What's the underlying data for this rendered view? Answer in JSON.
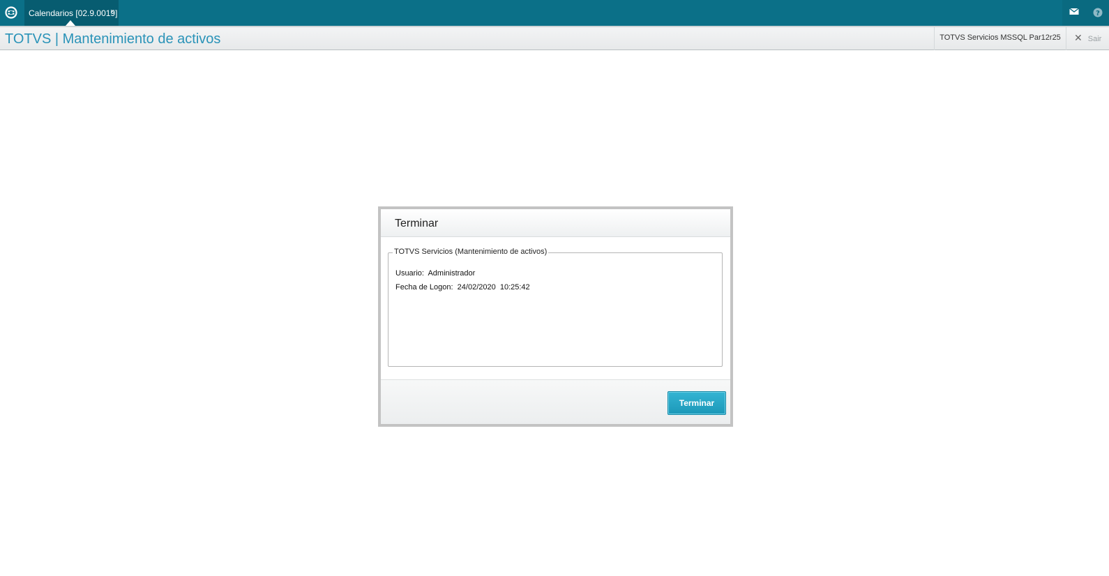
{
  "topbar": {
    "tab_label": "Calendarios [02.9.0019]",
    "tab_close": "×",
    "logo_icon": "totvs-logo-icon",
    "mail_icon": "mail-icon",
    "help_icon": "help-icon"
  },
  "titlebar": {
    "app_title": "TOTVS | Mantenimiento de activos",
    "environment": "TOTVS Servicios MSSQL Par12r25",
    "exit_icon": "close-icon",
    "exit_label": "Sair"
  },
  "dialog": {
    "title": "Terminar",
    "group_legend": "TOTVS Servicios (Mantenimiento de activos)",
    "user_line": "Usuario:  Administrador",
    "logon_line": "Fecha de Logon:  24/02/2020  10:25:42",
    "button_label": "Terminar"
  },
  "colors": {
    "topbar": "#0b7088",
    "accent_title": "#2a93b8",
    "button": "#1b98b8"
  }
}
